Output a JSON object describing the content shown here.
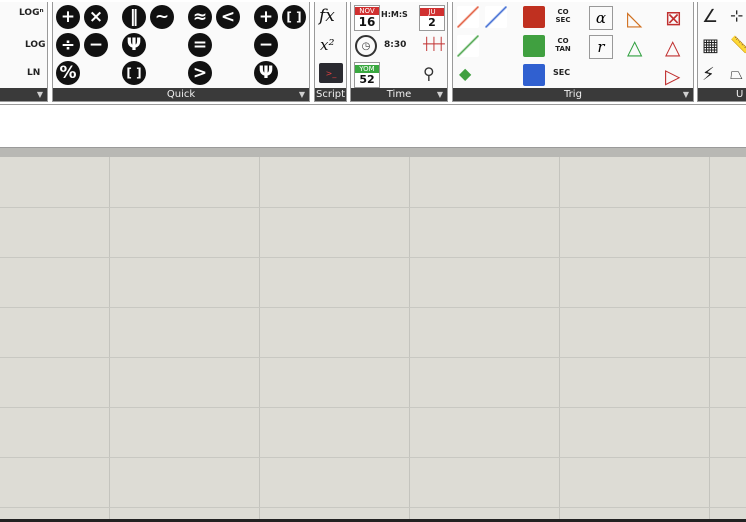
{
  "ribbon": {
    "groups": {
      "math": {
        "label": ""
      },
      "quick": {
        "label": "Quick"
      },
      "script": {
        "label": "Script"
      },
      "time": {
        "label": "Time"
      },
      "trig": {
        "label": "Trig"
      },
      "units": {
        "label": "U"
      }
    },
    "math_buttons": {
      "logn": "LOGⁿ",
      "log": "LOG",
      "ln": "LN"
    },
    "quick_buttons": [
      "+",
      "×",
      "‖",
      "~",
      "≈",
      "<",
      "+",
      "[ ]",
      "÷",
      "−",
      "Ψ",
      "=",
      "−",
      "%",
      "[ ]",
      ">",
      "Ψ"
    ],
    "script_buttons": {
      "fx": "fx",
      "power": "x²",
      "console": ">_"
    },
    "time_buttons": {
      "calendar_month": "NOV",
      "calendar_day": "16",
      "hms": "H:M:S",
      "clock_time": "8:30",
      "jul_month": "JU",
      "jul_day": "2",
      "yom_label": "YOM",
      "yom_day": "52"
    },
    "trig_buttons": {
      "cosec": "CO SEC",
      "cotan": "CO TAN",
      "sec": "SEC",
      "alpha": "α",
      "r": "r"
    }
  },
  "colors": {
    "ribbon_label_bg": "#3a3a3a",
    "canvas_bg": "#dddcd5",
    "grid_line": "#c4c4be"
  }
}
